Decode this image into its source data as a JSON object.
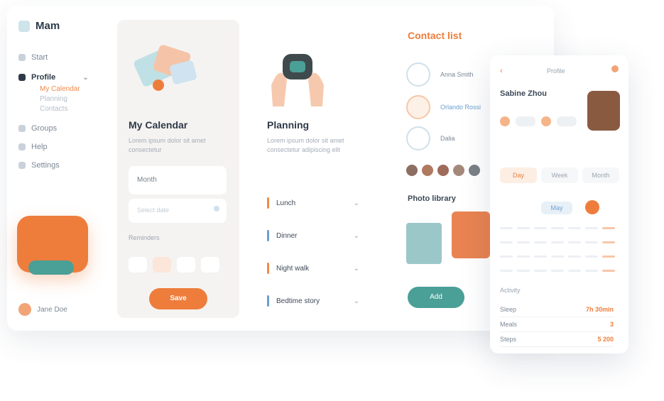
{
  "app": {
    "name": "Mam"
  },
  "sidebar": {
    "items": [
      {
        "label": "Start"
      },
      {
        "label": "Profile"
      },
      {
        "label": "Groups"
      },
      {
        "label": "Help"
      },
      {
        "label": "Settings"
      }
    ],
    "subitems": [
      "My Calendar",
      "Planning",
      "Contacts"
    ],
    "user_name": "Jane Doe"
  },
  "card_calendar": {
    "title": "My Calendar",
    "subtitle": "Lorem ipsum dolor sit amet consectetur",
    "field_value": "Month",
    "field2_placeholder": "Select date",
    "section_label": "Reminders",
    "button_label": "Save"
  },
  "card_planning": {
    "title": "Planning",
    "subtitle": "Lorem ipsum dolor sit amet consectetur adipiscing elit",
    "rows": [
      {
        "label": "Lunch",
        "color": "#f08a4b"
      },
      {
        "label": "Dinner",
        "color": "#6b9fd1"
      },
      {
        "label": "Night walk",
        "color": "#f08a4b"
      },
      {
        "label": "Bedtime story",
        "color": "#6b9fd1"
      }
    ]
  },
  "col_contacts": {
    "title": "Contact list",
    "people": [
      {
        "name": "Anna Smith"
      },
      {
        "name": "Orlando Rossi"
      },
      {
        "name": "Dalia"
      }
    ],
    "gallery_title": "Photo library",
    "button_label": "Add"
  },
  "phone": {
    "header_title": "Profile",
    "person_name": "Sabine Zhou",
    "tabs": [
      "Day",
      "Week",
      "Month"
    ],
    "week_label": "May",
    "stats_title": "Activity",
    "stats": [
      {
        "label": "Sleep",
        "value": "7h 30min"
      },
      {
        "label": "Meals",
        "value": "3"
      },
      {
        "label": "Steps",
        "value": "5 200"
      }
    ]
  },
  "colors": {
    "accent": "#ee7d3c",
    "teal": "#4a9f96"
  }
}
